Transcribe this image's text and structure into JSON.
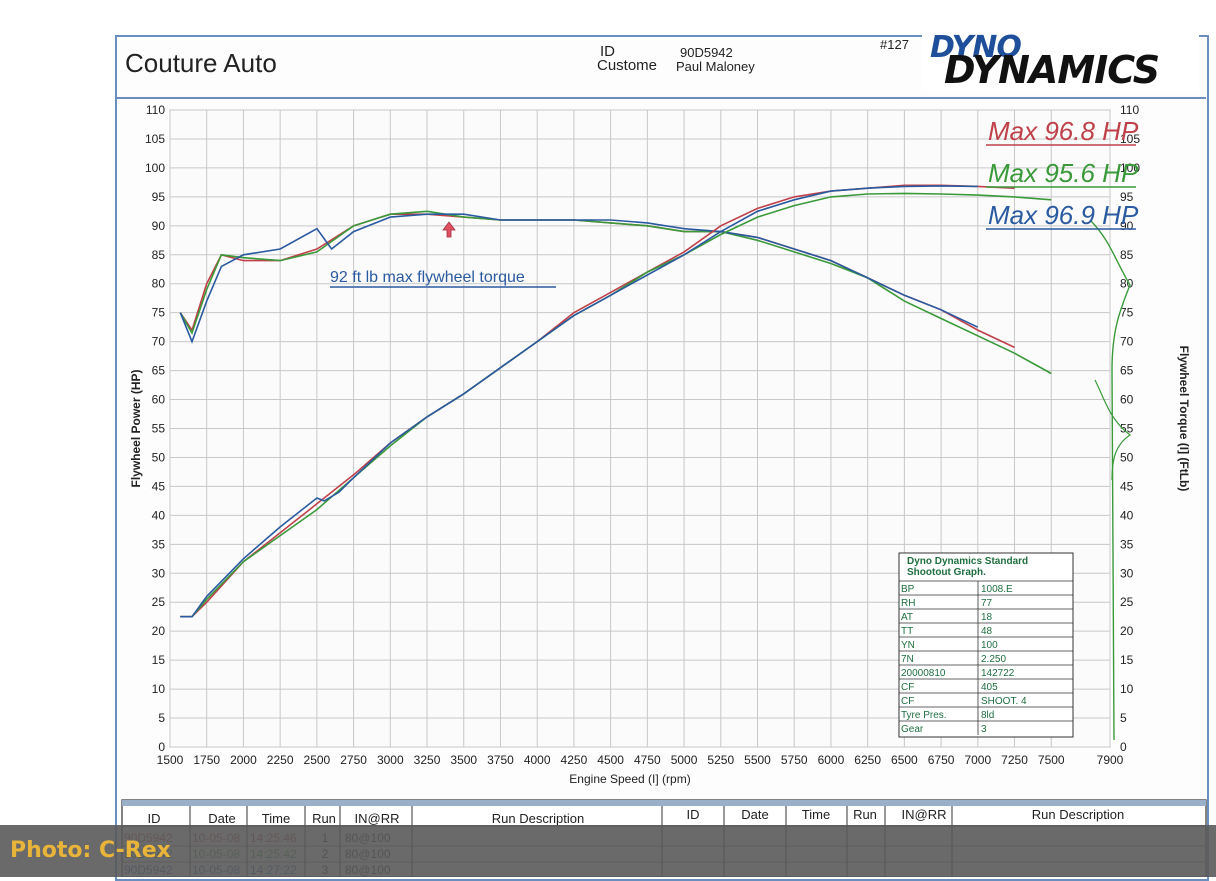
{
  "header": {
    "shop": "Couture Auto",
    "id_label": "ID",
    "id_value": "90D5942",
    "customer_label": "Custome",
    "customer_value": "Paul Maloney",
    "run_no": "#127",
    "logo_line1": "DYNO",
    "logo_line2": "DYNAMICS"
  },
  "chart_data": {
    "type": "line",
    "xlabel": "Engine Speed (I] (rpm)",
    "ylabel_left": "Flywheel Power (HP)",
    "ylabel_right": "Flywheel Torque (I] (FtLb)",
    "xlim": [
      1500,
      7900
    ],
    "ylim_left": [
      0,
      110
    ],
    "ylim_right": [
      0,
      110
    ],
    "x_ticks": [
      1500,
      1750,
      2000,
      2250,
      2500,
      2750,
      3000,
      3250,
      3500,
      3750,
      4000,
      4250,
      4500,
      4750,
      5000,
      5250,
      5500,
      5750,
      6000,
      6250,
      6500,
      6750,
      7000,
      7250,
      7500,
      7900
    ],
    "y_ticks": [
      0,
      5,
      10,
      15,
      20,
      25,
      30,
      35,
      40,
      45,
      50,
      55,
      60,
      65,
      70,
      75,
      80,
      85,
      90,
      95,
      100,
      105,
      110
    ],
    "grid": true,
    "annotations": {
      "torque_note": "92 ft lb max flywheel torque"
    },
    "max_labels": [
      {
        "text": "Max 96.8 HP",
        "color": "#c0404a"
      },
      {
        "text": "Max 95.6 HP",
        "color": "#3a9a3a"
      },
      {
        "text": "Max 96.9 HP",
        "color": "#2a5aa0"
      }
    ],
    "series": [
      {
        "kind": "torque",
        "color": "#c0404a",
        "x": [
          1570,
          1650,
          1750,
          1850,
          2000,
          2250,
          2500,
          2750,
          3000,
          3250,
          3500,
          3750,
          4000,
          4250,
          4500,
          4750,
          5000,
          5250,
          5500,
          5750,
          6000,
          6250,
          6500,
          6750,
          7000,
          7250
        ],
        "y": [
          75,
          72,
          80,
          85,
          84,
          84,
          86,
          90,
          92,
          92,
          91.5,
          91,
          91,
          91,
          90.5,
          90,
          89,
          89,
          88,
          86,
          84,
          81,
          78,
          75.5,
          72,
          69
        ]
      },
      {
        "kind": "torque",
        "color": "#3a9a3a",
        "x": [
          1570,
          1650,
          1750,
          1850,
          2000,
          2250,
          2500,
          2750,
          3000,
          3250,
          3500,
          3750,
          4000,
          4250,
          4500,
          4750,
          5000,
          5250,
          5500,
          5750,
          6000,
          6250,
          6500,
          6750,
          7000,
          7250,
          7500
        ],
        "y": [
          75,
          71.5,
          79,
          85,
          84.5,
          84,
          85.5,
          90,
          92,
          92.5,
          91.5,
          91,
          91,
          91,
          90.5,
          90,
          89,
          89,
          87.5,
          85.5,
          83.5,
          81,
          77,
          74,
          71,
          68,
          64.5
        ]
      },
      {
        "kind": "torque",
        "color": "#2a5aa0",
        "x": [
          1570,
          1650,
          1750,
          1850,
          2000,
          2250,
          2500,
          2600,
          2750,
          3000,
          3250,
          3500,
          3750,
          4000,
          4250,
          4500,
          4750,
          5000,
          5250,
          5500,
          5750,
          6000,
          6250,
          6500,
          6750,
          7000
        ],
        "y": [
          75,
          70,
          77,
          83,
          85,
          86,
          89.5,
          86,
          89,
          91.5,
          92,
          92,
          91,
          91,
          91,
          91,
          90.5,
          89.5,
          89,
          88,
          86,
          84,
          81,
          78,
          75.5,
          72.5
        ]
      },
      {
        "kind": "power",
        "color": "#c0404a",
        "x": [
          1570,
          1650,
          1750,
          2000,
          2250,
          2500,
          2750,
          3000,
          3250,
          3500,
          3750,
          4000,
          4250,
          4500,
          4750,
          5000,
          5250,
          5500,
          5750,
          6000,
          6250,
          6500,
          6750,
          7000,
          7250
        ],
        "y": [
          22.5,
          22.5,
          25,
          32,
          37,
          42,
          47,
          52.5,
          57,
          61,
          65.5,
          70,
          75,
          78.5,
          82,
          85.5,
          90,
          93,
          95,
          96,
          96.5,
          97,
          97,
          96.8,
          96.5
        ]
      },
      {
        "kind": "power",
        "color": "#3a9a3a",
        "x": [
          1570,
          1650,
          1750,
          2000,
          2250,
          2500,
          2750,
          3000,
          3250,
          3500,
          3750,
          4000,
          4250,
          4500,
          4750,
          5000,
          5250,
          5500,
          5750,
          6000,
          6250,
          6500,
          6750,
          7000,
          7250,
          7500
        ],
        "y": [
          22.5,
          22.5,
          25.5,
          32,
          36.5,
          41,
          46.5,
          52,
          57,
          61,
          65.5,
          70,
          74.5,
          78,
          82,
          85,
          88.5,
          91.5,
          93.5,
          95,
          95.5,
          95.6,
          95.5,
          95.3,
          95,
          94.5
        ]
      },
      {
        "kind": "power",
        "color": "#2a5aa0",
        "x": [
          1570,
          1650,
          1750,
          2000,
          2250,
          2500,
          2550,
          2650,
          2750,
          3000,
          3250,
          3500,
          3750,
          4000,
          4250,
          4500,
          4750,
          5000,
          5250,
          5500,
          5750,
          6000,
          6250,
          6500,
          6750,
          7000
        ],
        "y": [
          22.5,
          22.5,
          26,
          32.5,
          38,
          43,
          42.5,
          44,
          46.5,
          52.5,
          57,
          61,
          65.5,
          70,
          74.5,
          78,
          81.5,
          85,
          89,
          92.5,
          94.5,
          96,
          96.5,
          96.8,
          96.9,
          96.8
        ]
      }
    ]
  },
  "info_table": {
    "title1": "Dyno Dynamics Standard",
    "title2": "Shootout Graph.",
    "rows": [
      [
        "BP",
        "1008.E"
      ],
      [
        "RH",
        "77"
      ],
      [
        "AT",
        "18"
      ],
      [
        "TT",
        "48"
      ],
      [
        "YN",
        "100"
      ],
      [
        "7N",
        "2.250"
      ],
      [
        "20000810",
        "142722"
      ],
      [
        "CF",
        "405"
      ],
      [
        "CF",
        "SHOOT. 4"
      ],
      [
        "Tyre Pres.",
        "8ld"
      ],
      [
        "Gear",
        "3"
      ]
    ]
  },
  "run_table": {
    "headers": [
      "ID",
      "Date",
      "Time",
      "Run",
      "IN@RR",
      "Run Description",
      "ID",
      "Date",
      "Time",
      "Run",
      "IN@RR",
      "Run Description"
    ],
    "rows": [
      {
        "id": "90D5942",
        "date": "10-05-08",
        "time": "14:25:46",
        "run": "1",
        "in": "80@100",
        "color": "#c0404a"
      },
      {
        "id": "90D5942",
        "date": "10-05-08",
        "time": "14:25:42",
        "run": "2",
        "in": "80@100",
        "color": "#3a9a3a"
      },
      {
        "id": "90D5942",
        "date": "10-05-08",
        "time": "14:27:22",
        "run": "3",
        "in": "80@100",
        "color": "#2a5aa0"
      }
    ]
  },
  "credit": "Photo: C-Rex"
}
